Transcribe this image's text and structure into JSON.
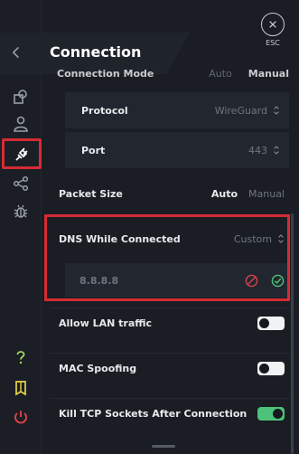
{
  "header": {
    "title": "Connection",
    "esc_label": "ESC"
  },
  "sidebar": {
    "items": [
      {
        "icon": "settings-shapes-icon"
      },
      {
        "icon": "user-icon"
      },
      {
        "icon": "connection-plug-icon",
        "active": true
      },
      {
        "icon": "share-icon"
      },
      {
        "icon": "bug-icon"
      }
    ],
    "bottom": [
      {
        "icon": "help-question-icon",
        "color": "#a3d65c"
      },
      {
        "icon": "guide-book-icon",
        "color": "#e7d34b"
      },
      {
        "icon": "power-icon",
        "color": "#e8434c"
      }
    ]
  },
  "settings": {
    "connection_mode": {
      "label": "Connection Mode",
      "options": [
        "Auto",
        "Manual"
      ]
    },
    "protocol": {
      "label": "Protocol",
      "value": "WireGuard"
    },
    "port": {
      "label": "Port",
      "value": "443"
    },
    "packet_size": {
      "label": "Packet Size",
      "options": [
        "Auto",
        "Manual"
      ],
      "selected": "Auto"
    },
    "dns": {
      "label": "DNS While Connected",
      "value": "Custom",
      "ip": "8.8.8.8"
    },
    "allow_lan": {
      "label": "Allow LAN traffic",
      "enabled": false
    },
    "mac_spoofing": {
      "label": "MAC Spoofing",
      "enabled": false
    },
    "kill_tcp": {
      "label": "Kill TCP Sockets After Connection",
      "enabled": true
    }
  },
  "colors": {
    "accent_green": "#4cc27a",
    "highlight_red": "#d62b34",
    "background": "#1a1d24"
  }
}
